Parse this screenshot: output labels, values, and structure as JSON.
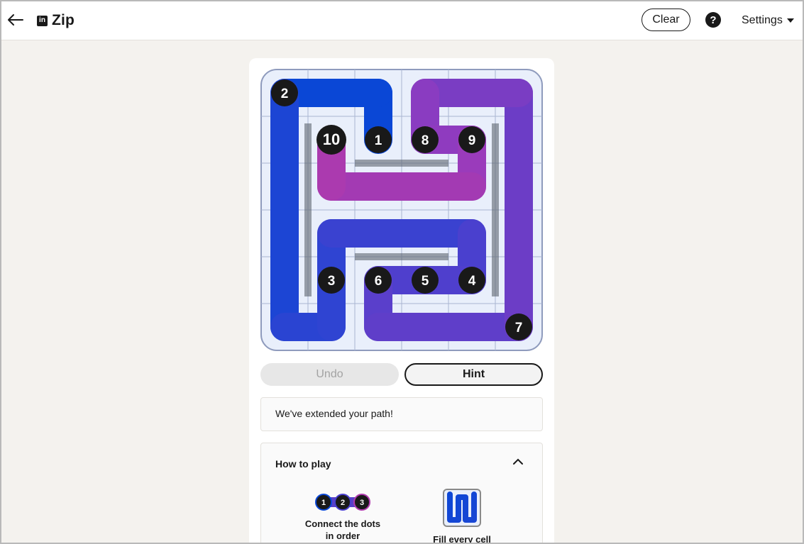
{
  "header": {
    "title": "Zip",
    "logo_text": "in",
    "clear_label": "Clear",
    "help_symbol": "?",
    "settings_label": "Settings"
  },
  "puzzle": {
    "grid_size": 6,
    "path_cells": [
      [
        2,
        1
      ],
      [
        2,
        0
      ],
      [
        1,
        0
      ],
      [
        0,
        0
      ],
      [
        0,
        1
      ],
      [
        0,
        2
      ],
      [
        0,
        3
      ],
      [
        0,
        4
      ],
      [
        0,
        5
      ],
      [
        1,
        5
      ],
      [
        1,
        4
      ],
      [
        1,
        3
      ],
      [
        2,
        3
      ],
      [
        3,
        3
      ],
      [
        4,
        3
      ],
      [
        5,
        3
      ],
      [
        5,
        4
      ],
      [
        5,
        5
      ],
      [
        4,
        5
      ],
      [
        3,
        5
      ],
      [
        2,
        5
      ],
      [
        2,
        4
      ],
      [
        3,
        4
      ],
      [
        4,
        4
      ],
      [
        5,
        4
      ],
      [
        5,
        5
      ],
      [
        5,
        6
      ]
    ],
    "dots": [
      {
        "label": "1",
        "cell": [
          2,
          1
        ]
      },
      {
        "label": "2",
        "cell": [
          0,
          0
        ]
      },
      {
        "label": "3",
        "cell": [
          1,
          4
        ]
      },
      {
        "label": "4",
        "cell": [
          4,
          4
        ]
      },
      {
        "label": "5",
        "cell": [
          3,
          4
        ]
      },
      {
        "label": "6",
        "cell": [
          2,
          4
        ]
      },
      {
        "label": "7",
        "cell": [
          5,
          5
        ]
      },
      {
        "label": "8",
        "cell": [
          3,
          1
        ]
      },
      {
        "label": "9",
        "cell": [
          4,
          1
        ]
      },
      {
        "label": "10",
        "cell": [
          1,
          1
        ]
      }
    ],
    "colors": {
      "start": "#0a47d6",
      "mid": "#4a3fd0",
      "purple": "#7d3fc2",
      "magenta": "#b03aae",
      "cell_bg": "#e9effb",
      "grid_line": "#a9b6d1",
      "wall": "#5f6670"
    }
  },
  "buttons": {
    "undo_label": "Undo",
    "hint_label": "Hint"
  },
  "message": "We've extended your path!",
  "how_to_play": {
    "title": "How to play",
    "tip1_dots": [
      "1",
      "2",
      "3"
    ],
    "tip1_text": "Connect the dots in order",
    "tip2_text": "Fill every cell"
  }
}
